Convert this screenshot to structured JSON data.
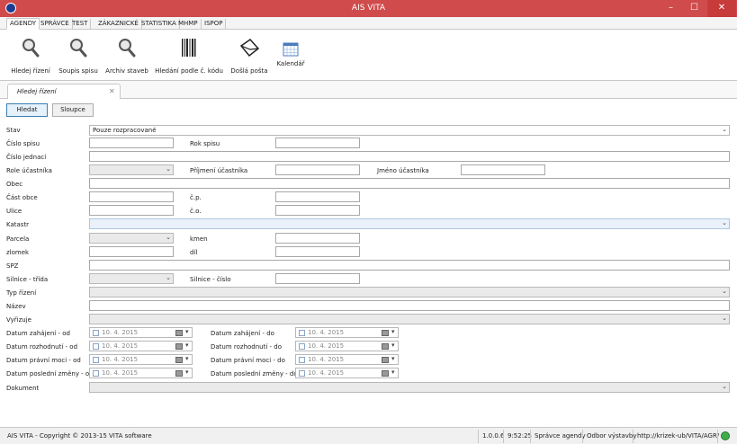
{
  "window": {
    "title": "AIS VITA",
    "min": "–",
    "max": "☐",
    "close": "✕"
  },
  "ribbon_tabs": [
    "AGENDY",
    "SPRÁVCE",
    "TEST",
    "ZÁKAZNICKÉ",
    "STATISTIKA",
    "MHMP",
    "ISPOP"
  ],
  "ribbon_buttons": {
    "hledej": "Hledej řízení",
    "soupis": "Soupis spisu",
    "archiv": "Archiv staveb",
    "kod": "Hledání podle č. kódu",
    "posta": "Došlá pošta",
    "kalendar": "Kalendář"
  },
  "doc_tab": {
    "label": "Hledej řízení",
    "close": "✕"
  },
  "buttons": {
    "hledat": "Hledat",
    "sloupce": "Sloupce"
  },
  "form": {
    "stav": "Stav",
    "stav_value": "Pouze rozpracované",
    "cislo_spisu": "Číslo spisu",
    "rok_spisu": "Rok spisu",
    "cislo_jednaci": "Číslo jednací",
    "role": "Role účastníka",
    "prijmeni": "Příjmení účastníka",
    "jmeno": "Jméno účastníka",
    "obec": "Obec",
    "cast_obce": "Část obce",
    "cp": "č.p.",
    "ulice": "Ulice",
    "co": "č.o.",
    "katastr": "Katastr",
    "parcela": "Parcela",
    "kmen": "kmen",
    "zlomek": "zlomek",
    "dil": "díl",
    "spz": "SPZ",
    "silnice_trida": "Silnice - třída",
    "silnice_cislo": "Silnice - číslo",
    "typ_rizeni": "Typ řízení",
    "nazev": "Název",
    "vyrizuje": "Vyřizuje",
    "zahajeni_od": "Datum zahájení - od",
    "zahajeni_do": "Datum zahájení - do",
    "rozhodnuti_od": "Datum rozhodnutí - od",
    "rozhodnuti_do": "Datum rozhodnutí - do",
    "pravni_od": "Datum právní moci - od",
    "pravni_do": "Datum právní moci - do",
    "zmena_od": "Datum poslední změny - od",
    "zmena_do": "Datum poslední změny - do",
    "dokument": "Dokument",
    "date_value": "10.   4. 2015"
  },
  "status": {
    "copyright": "AIS VITA - Copyright © 2013-15 VITA software",
    "version": "1.0.0.6",
    "time": "9:52:25",
    "role": "Správce agendy",
    "dept": "Odbor výstavby",
    "url": "http://krizek-ub/VITA/AGR/"
  }
}
